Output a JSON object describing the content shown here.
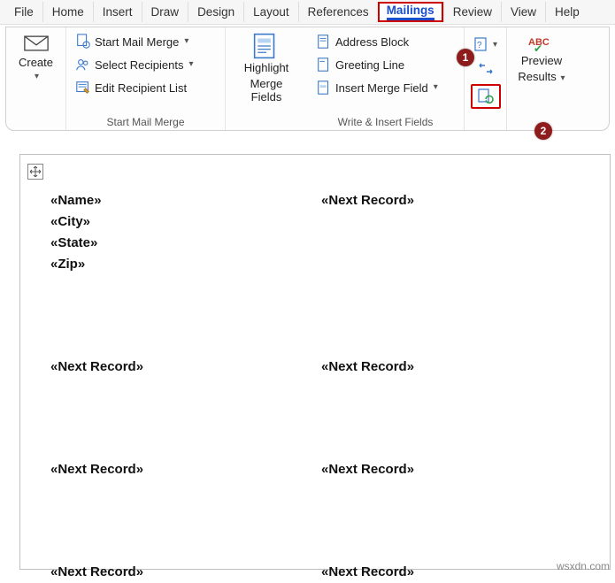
{
  "tabs": [
    "File",
    "Home",
    "Insert",
    "Draw",
    "Design",
    "Layout",
    "References",
    "Mailings",
    "Review",
    "View",
    "Help"
  ],
  "active_tab": "Mailings",
  "ribbon": {
    "create_group": {
      "create": "Create"
    },
    "mailmerge_group": {
      "start_mail_merge": "Start Mail Merge",
      "select_recipients": "Select Recipients",
      "edit_recipient_list": "Edit Recipient List",
      "label": "Start Mail Merge"
    },
    "highlight_group": {
      "highlight_line1": "Highlight",
      "highlight_line2": "Merge Fields"
    },
    "insert_group": {
      "address_block": "Address Block",
      "greeting_line": "Greeting Line",
      "insert_merge_field": "Insert Merge Field",
      "label": "Write & Insert Fields"
    },
    "preview_group": {
      "preview_line1": "Preview",
      "preview_line2": "Results"
    }
  },
  "badges": {
    "one": "1",
    "two": "2"
  },
  "doc": {
    "fields": {
      "name": "«Name»",
      "city": "«City»",
      "state": "«State»",
      "zip": "«Zip»"
    },
    "next_record": "«Next Record»"
  },
  "watermark": "wsxdn.com"
}
